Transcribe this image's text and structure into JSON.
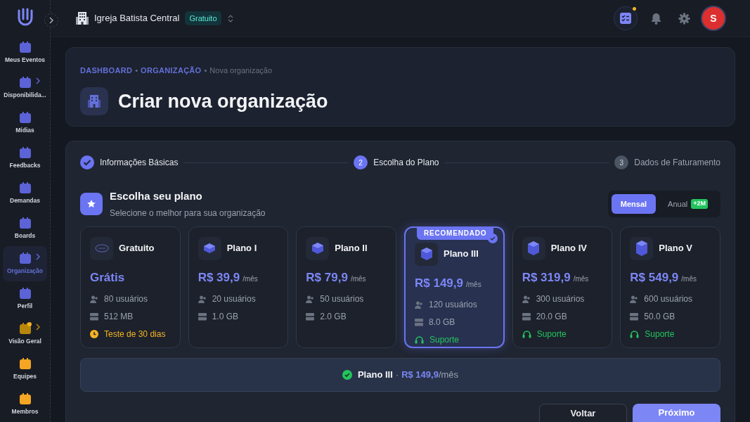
{
  "sidebar": {
    "items": [
      {
        "label": "Meus Eventos",
        "color": "#5b63d6",
        "expandable": false,
        "selected": false,
        "dot": false
      },
      {
        "label": "Disponibilida...",
        "color": "#5b63d6",
        "expandable": true,
        "selected": false,
        "dot": false
      },
      {
        "label": "Mídias",
        "color": "#5b63d6",
        "expandable": false,
        "selected": false,
        "dot": false
      },
      {
        "label": "Feedbacks",
        "color": "#5b63d6",
        "expandable": false,
        "selected": false,
        "dot": false
      },
      {
        "label": "Demandas",
        "color": "#5b63d6",
        "expandable": false,
        "selected": false,
        "dot": false
      },
      {
        "label": "Boards",
        "color": "#5b63d6",
        "expandable": false,
        "selected": false,
        "dot": false
      },
      {
        "label": "Organização",
        "color": "#5b63d6",
        "expandable": true,
        "selected": true,
        "dot": false
      },
      {
        "label": "Perfil",
        "color": "#5b63d6",
        "expandable": false,
        "selected": false,
        "dot": false
      },
      {
        "label": "Visão Geral",
        "color": "#b8860b",
        "expandable": true,
        "selected": false,
        "dot": true
      },
      {
        "label": "Equipes",
        "color": "#f5a524",
        "expandable": false,
        "selected": false,
        "dot": false
      },
      {
        "label": "Membros",
        "color": "#f5a524",
        "expandable": false,
        "selected": false,
        "dot": false
      }
    ]
  },
  "topbar": {
    "organization": "Igreja Batista Central",
    "plan_badge": "Gratuito",
    "tasks_notification": true,
    "avatar_initial": "S"
  },
  "header": {
    "breadcrumb": [
      {
        "label": "DASHBOARD",
        "link": true
      },
      {
        "label": "ORGANIZAÇÃO",
        "link": true
      },
      {
        "label": "Nova organização",
        "link": false
      }
    ],
    "separator": "•",
    "title": "Criar nova organização"
  },
  "steps": [
    {
      "label": "Informações Básicas",
      "kind": "done"
    },
    {
      "label": "Escolha do Plano",
      "kind": "current",
      "number": "2"
    },
    {
      "label": "Dados de Faturamento",
      "kind": "pending",
      "number": "3"
    }
  ],
  "section": {
    "title": "Escolha seu plano",
    "subtitle": "Selecione o melhor para sua organização"
  },
  "billing": [
    {
      "label": "Mensal",
      "selected": true
    },
    {
      "label": "Anual",
      "selected": false,
      "badge": "+2M"
    }
  ],
  "plans": [
    {
      "name": "Gratuito",
      "price": "Grátis",
      "selected": false,
      "features": [
        {
          "kind": "users",
          "text": "80 usuários"
        },
        {
          "kind": "storage",
          "text": "512 MB"
        },
        {
          "kind": "trial",
          "text": "Teste de 30 dias"
        }
      ]
    },
    {
      "name": "Plano I",
      "price": "R$ 39,9",
      "period": "/mês",
      "selected": false,
      "features": [
        {
          "kind": "users",
          "text": "20 usuários"
        },
        {
          "kind": "storage",
          "text": "1.0 GB"
        }
      ]
    },
    {
      "name": "Plano II",
      "price": "R$ 79,9",
      "period": "/mês",
      "selected": false,
      "features": [
        {
          "kind": "users",
          "text": "50 usuários"
        },
        {
          "kind": "storage",
          "text": "2.0 GB"
        }
      ]
    },
    {
      "name": "Plano III",
      "price": "R$ 149,9",
      "period": "/mês",
      "selected": true,
      "badge": "RECOMENDADO",
      "features": [
        {
          "kind": "users",
          "text": "120 usuários"
        },
        {
          "kind": "storage",
          "text": "8.0 GB"
        },
        {
          "kind": "support",
          "text": "Suporte"
        }
      ]
    },
    {
      "name": "Plano IV",
      "price": "R$ 319,9",
      "period": "/mês",
      "selected": false,
      "features": [
        {
          "kind": "users",
          "text": "300 usuários"
        },
        {
          "kind": "storage",
          "text": "20.0 GB"
        },
        {
          "kind": "support",
          "text": "Suporte"
        }
      ]
    },
    {
      "name": "Plano V",
      "price": "R$ 549,9",
      "period": "/mês",
      "selected": false,
      "features": [
        {
          "kind": "users",
          "text": "600 usuários"
        },
        {
          "kind": "storage",
          "text": "50.0 GB"
        },
        {
          "kind": "support",
          "text": "Suporte"
        }
      ]
    }
  ],
  "summary": {
    "plan": "Plano III",
    "separator": "·",
    "price": "R$ 149,9",
    "period": "/mês"
  },
  "buttons": [
    {
      "label": "Voltar",
      "kind": "secondary"
    },
    {
      "label": "Próximo",
      "kind": "primary"
    }
  ]
}
